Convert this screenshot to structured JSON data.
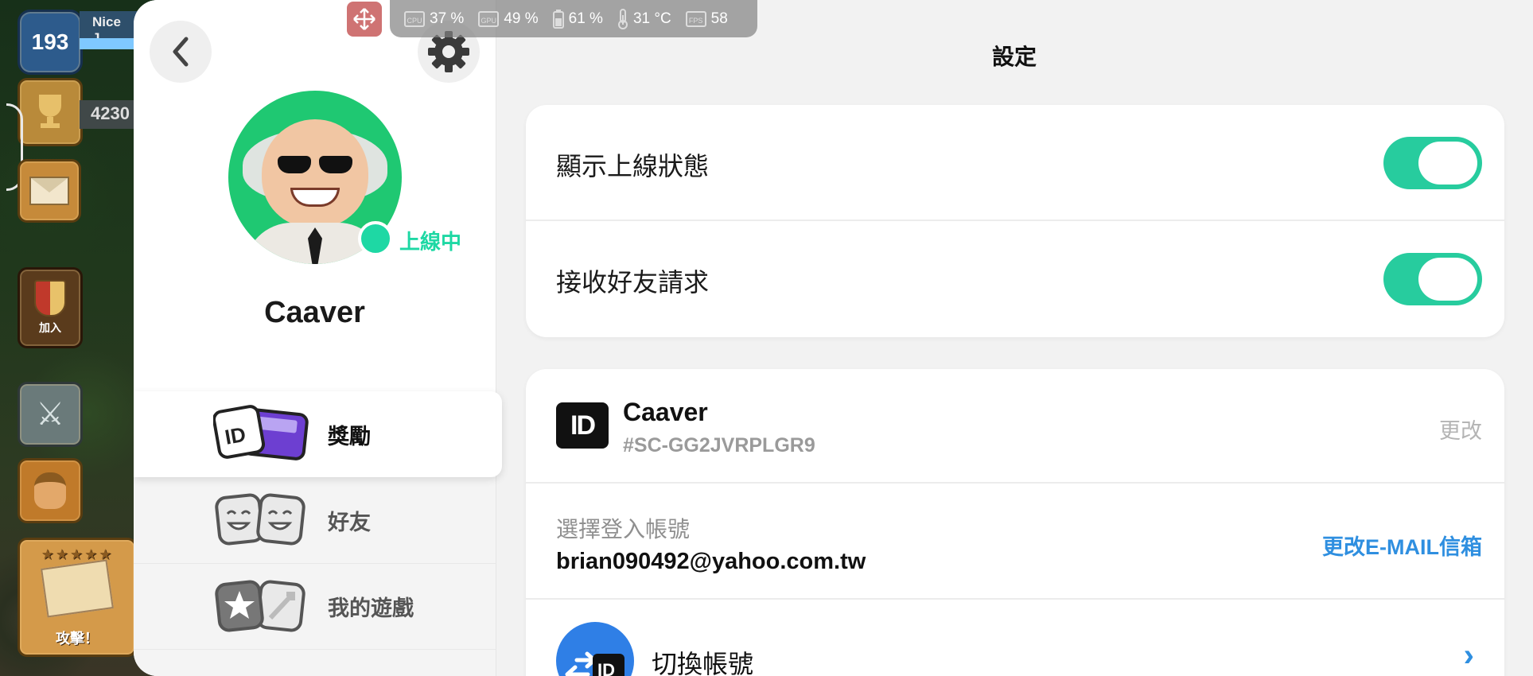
{
  "game": {
    "level": "193",
    "player_name": "Nice J",
    "trophies": "4230",
    "join_label": "加入",
    "attack_label": "攻擊！",
    "attack_stars": "★★★★★"
  },
  "overlay": {
    "cpu": "37 %",
    "gpu": "49 %",
    "battery": "61 %",
    "temperature": "31 °C",
    "fps": "58",
    "cpu_chip": "CPU",
    "gpu_chip": "GPU",
    "fps_chip": "FPS"
  },
  "profile": {
    "username": "Caaver",
    "status": "上線中"
  },
  "menu": [
    {
      "label": "獎勵"
    },
    {
      "label": "好友"
    },
    {
      "label": "我的遊戲"
    }
  ],
  "settings": {
    "title": "設定",
    "toggles": [
      {
        "label": "顯示上線狀態",
        "on": true
      },
      {
        "label": "接收好友請求",
        "on": true
      }
    ],
    "account": {
      "badge": "ID",
      "name": "Caaver",
      "tag": "#SC-GG2JVRPLGR9",
      "change_label": "更改"
    },
    "login": {
      "caption": "選擇登入帳號",
      "email": "brian090492@yahoo.com.tw",
      "change_label": "更改E-MAIL信箱"
    },
    "switch": {
      "label": "切換帳號",
      "chevron": "›"
    }
  },
  "colors": {
    "accent_green": "#27cc9e",
    "link_blue": "#2f8fe0",
    "online_green": "#1ed8a4"
  }
}
